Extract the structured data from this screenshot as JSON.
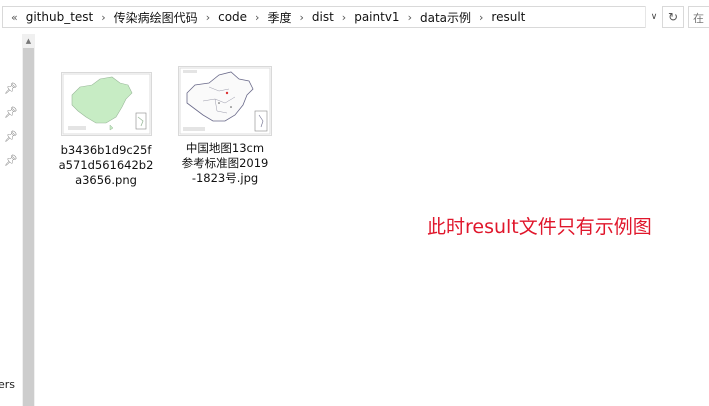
{
  "address_bar": {
    "breadcrumbs": [
      "github_test",
      "传染病绘图代码",
      "code",
      "季度",
      "dist",
      "paintv1",
      "data示例",
      "result"
    ],
    "overflow_glyph": "«",
    "separator_glyph": "›",
    "dropdown_glyph": "∨",
    "refresh_glyph": "↻",
    "search_partial": "在"
  },
  "nav_pane": {
    "partial_label": "ers"
  },
  "files": [
    {
      "name": "b3436b1d9c25fa571d561642b2a3656.png",
      "thumb_icon": "china-map-green-icon"
    },
    {
      "name": "中国地图13cm参考标准图2019-1823号.jpg",
      "thumb_icon": "china-map-standard-icon"
    }
  ],
  "annotation": "此时result文件只有示例图",
  "colors": {
    "annotation": "#e0162b",
    "map_fill": "#c7ecc4"
  }
}
